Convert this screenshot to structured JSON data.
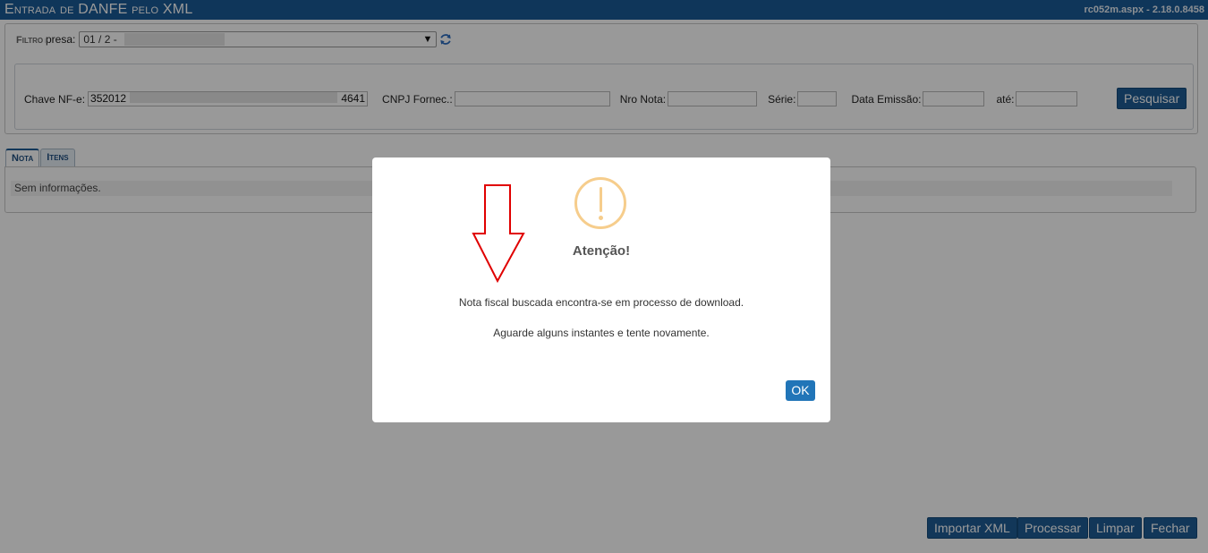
{
  "titlebar": {
    "title": "Entrada de DANFE pelo XML",
    "version": "rc052m.aspx - 2.18.0.8458"
  },
  "empresa": {
    "label": "Empresa:",
    "value": "01 / 2 -"
  },
  "filtro": {
    "legend": "Filtro",
    "chave_label": "Chave NF-e:",
    "chave_start": "352012",
    "chave_end": "4641",
    "cnpj_label": "CNPJ Fornec.:",
    "cnpj_value": "",
    "nro_label": "Nro Nota:",
    "nro_value": "",
    "serie_label": "Série:",
    "serie_value": "",
    "data_label": "Data Emissão:",
    "data_value": "",
    "ate_label": "até:",
    "ate_value": "",
    "search_button": "Pesquisar"
  },
  "tabs": [
    {
      "label": "Nota"
    },
    {
      "label": "Itens"
    }
  ],
  "tab_body": {
    "info": "Sem informações."
  },
  "actions": {
    "import": "Importar XML",
    "process": "Processar",
    "clear": "Limpar",
    "close": "Fechar"
  },
  "dialog": {
    "icon": "warning-icon",
    "title": "Atenção!",
    "line1": "Nota fiscal buscada encontra-se em processo de download.",
    "line2": "Aguarde alguns instantes e tente novamente.",
    "ok_button": "OK"
  },
  "colors": {
    "primary": "#1f5d95",
    "dialog_button": "#2175b8",
    "warning": "#f6cd8c",
    "annotation_arrow": "#e00000"
  }
}
